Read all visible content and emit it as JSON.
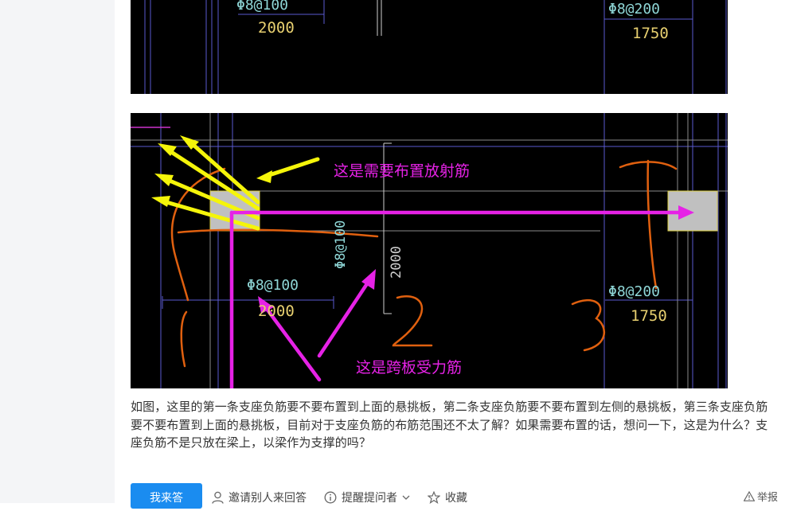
{
  "image1": {
    "labels": {
      "rebar_left": "Φ8@100",
      "dim_left": "2000",
      "rebar_right": "Φ8@200",
      "dim_right": "1750"
    }
  },
  "image2": {
    "annotation_radial": "这是需要布置放射筋",
    "annotation_span": "这是跨板受力筋",
    "rebar_left": "Φ8@100",
    "dim_left": "2000",
    "rebar_vertical": "Φ8@100",
    "dim_vertical": "2000",
    "rebar_right": "Φ8@200",
    "dim_right": "1750",
    "colors": {
      "annotation": "#e622e6",
      "arrow_yellow": "#f5f50a",
      "handwriting": "#e0600f",
      "cad_bg": "#000000"
    }
  },
  "question": {
    "text": "如图，这里的第一条支座负筋要不要布置到上面的悬挑板，第二条支座负筋要不要布置到左侧的悬挑板，第三条支座负筋要不要布置到上面的悬挑板，目前对于支座负筋的布筋范围还不太了解？如果需要布置的话，想问一下，这是为什么？支座负筋不是只放在梁上，以梁作为支撑的吗？"
  },
  "actions": {
    "answer_label": "我来答",
    "invite_label": "邀请别人来回答",
    "remind_label": "提醒提问者",
    "favorite_label": "收藏",
    "report_label": "举报",
    "accent": "#1a8cf0"
  }
}
